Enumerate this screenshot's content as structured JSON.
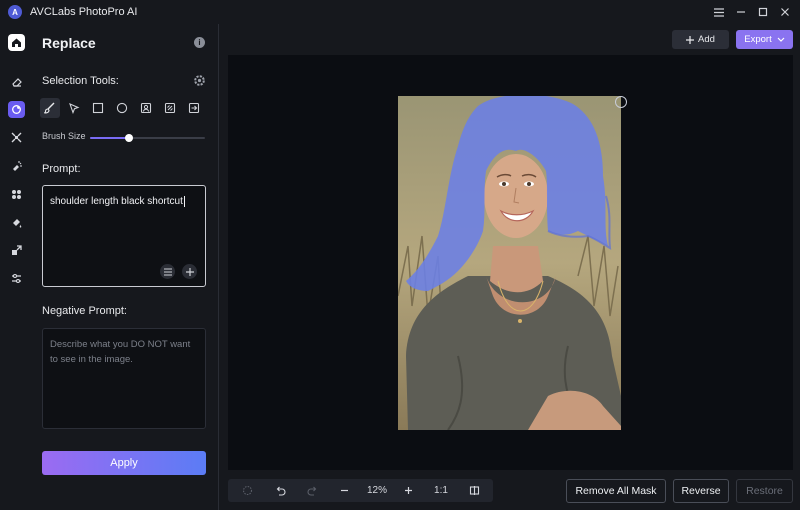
{
  "window": {
    "title": "AVCLabs PhotoPro AI",
    "controls": [
      "menu-icon",
      "minimize-icon",
      "maximize-icon",
      "close-icon"
    ]
  },
  "rail": {
    "items": [
      "home-icon",
      "eraser-icon",
      "replace-icon",
      "enhance-icon",
      "colorize-icon",
      "background-icon",
      "fill-icon",
      "resize-icon",
      "adjust-icon"
    ],
    "active": "replace-icon"
  },
  "panel": {
    "title": "Replace",
    "selection_tools_label": "Selection Tools:",
    "tools": [
      "brush-icon",
      "pointer-icon",
      "rectangle-icon",
      "ellipse-icon",
      "portrait-icon",
      "auto-select-icon",
      "import-icon"
    ],
    "active_tool": "brush-icon",
    "brush_size_label": "Brush Size",
    "brush_size_fraction": 0.34,
    "prompt_label": "Prompt:",
    "prompt_value": "shoulder length black shortcut",
    "negative_prompt_label": "Negative Prompt:",
    "negative_prompt_placeholder": "Describe what you DO NOT want to see in the image.",
    "apply_label": "Apply"
  },
  "header": {
    "add_label": "Add",
    "export_label": "Export"
  },
  "toolbar": {
    "zoom": "12%",
    "one_to_one": "1:1",
    "remove_all_mask_label": "Remove All Mask",
    "reverse_label": "Reverse",
    "restore_label": "Restore"
  },
  "colors": {
    "accent": "#8a73f0",
    "apply_gradient_start": "#9b6bf2",
    "apply_gradient_end": "#5b7cf5",
    "mask": "#6b80e6",
    "background": "#16181d",
    "canvas": "#0b0d12"
  }
}
